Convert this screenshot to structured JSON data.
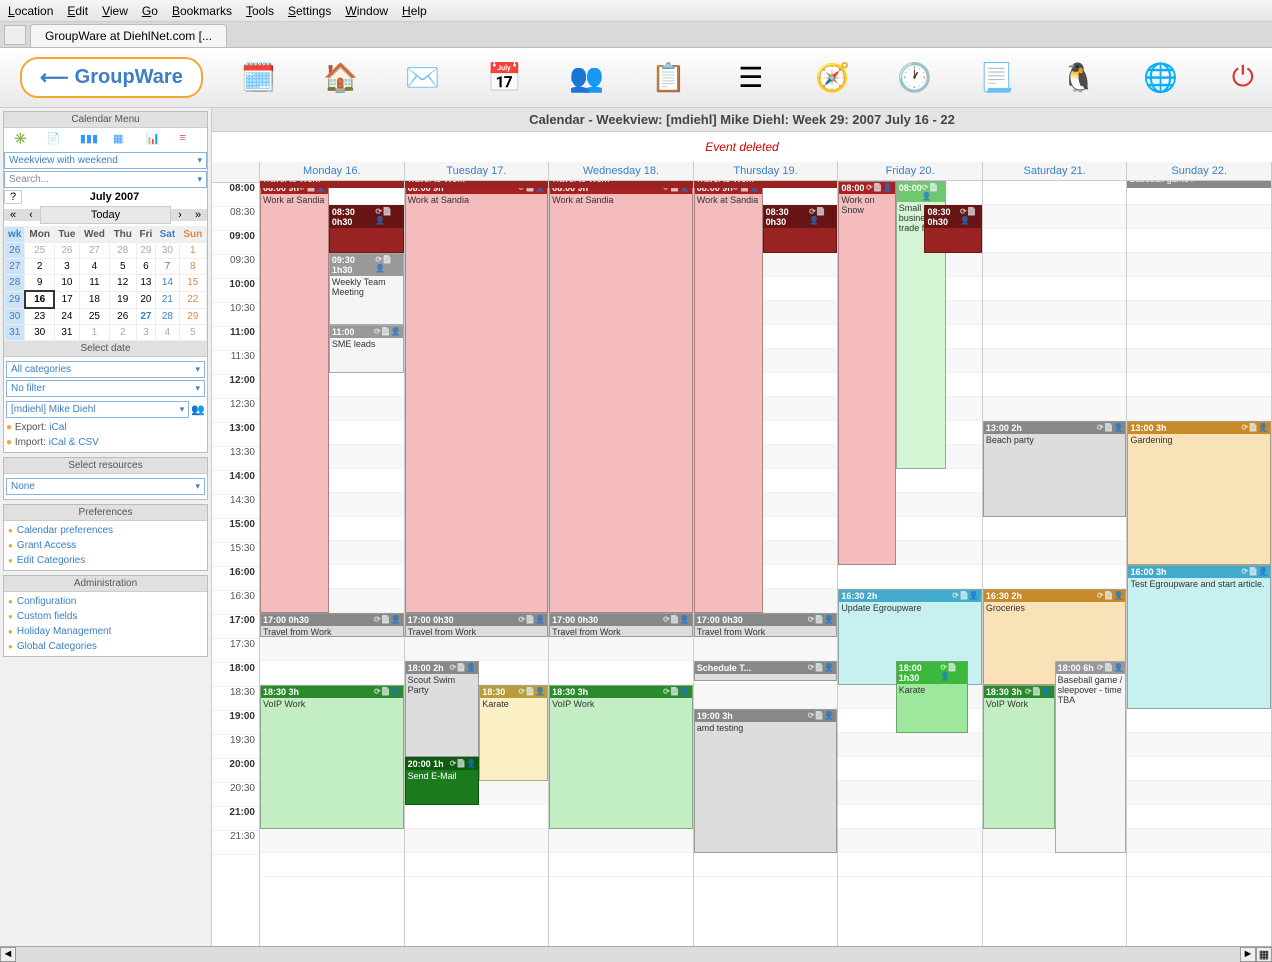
{
  "menubar": [
    "Location",
    "Edit",
    "View",
    "Go",
    "Bookmarks",
    "Tools",
    "Settings",
    "Window",
    "Help"
  ],
  "tab_title": "GroupWare at DiehlNet.com [...",
  "logo_text": "GroupWare",
  "sidebar": {
    "calendar_menu_title": "Calendar Menu",
    "view_select": "Weekview with weekend",
    "search_placeholder": "Search...",
    "month_title": "July 2007",
    "today_label": "Today",
    "select_date_label": "Select date",
    "category_select": "All categories",
    "filter_select": "No filter",
    "user_select": "[mdiehl] Mike Diehl",
    "export_label": "Export:",
    "export_link": "iCal",
    "import_label": "Import:",
    "import_link": "iCal & CSV",
    "resources_title": "Select resources",
    "resources_select": "None",
    "preferences_title": "Preferences",
    "pref_links": [
      "Calendar preferences",
      "Grant Access",
      "Edit Categories"
    ],
    "admin_title": "Administration",
    "admin_links": [
      "Configuration",
      "Custom fields",
      "Holiday Management",
      "Global Categories"
    ],
    "cal_headers": [
      "wk",
      "Mon",
      "Tue",
      "Wed",
      "Thu",
      "Fri",
      "Sat",
      "Sun"
    ],
    "cal_rows": [
      [
        "26",
        "25",
        "26",
        "27",
        "28",
        "29",
        "30",
        "1"
      ],
      [
        "27",
        "2",
        "3",
        "4",
        "5",
        "6",
        "7",
        "8"
      ],
      [
        "28",
        "9",
        "10",
        "11",
        "12",
        "13",
        "14",
        "15"
      ],
      [
        "29",
        "16",
        "17",
        "18",
        "19",
        "20",
        "21",
        "22"
      ],
      [
        "30",
        "23",
        "24",
        "25",
        "26",
        "27",
        "28",
        "29"
      ],
      [
        "31",
        "30",
        "31",
        "1",
        "2",
        "3",
        "4",
        "5"
      ]
    ]
  },
  "content_header": "Calendar - Weekview: [mdiehl] Mike Diehl: Week 29: 2007 July 16 - 22",
  "event_deleted": "Event deleted",
  "days": [
    "Monday 16.",
    "Tuesday 17.",
    "Wednesday 18.",
    "Thursday 19.",
    "Friday 20.",
    "Saturday 21.",
    "Sunday 22."
  ],
  "time_slots": [
    "08:00",
    "08:30",
    "09:00",
    "09:30",
    "10:00",
    "10:30",
    "11:00",
    "11:30",
    "12:00",
    "12:30",
    "13:00",
    "13:30",
    "14:00",
    "14:30",
    "15:00",
    "15:30",
    "16:00",
    "16:30",
    "17:00",
    "17:30",
    "18:00",
    "18:30",
    "19:00",
    "19:30",
    "20:00",
    "20:30",
    "21:00",
    "21:30"
  ],
  "events": {
    "travel_to_work": "Travel to Work",
    "travel_from_work": "Travel from Work",
    "work_sandia_hdr": "08:00 9h",
    "work_sandia": "Work at Sandia",
    "work_snow": "Work on Snow",
    "small_biz": "Small business trade fair",
    "small_biz_hdr": "08:00",
    "slot_0830": "08:30 0h30",
    "weekly_hdr": "09:30 1h30",
    "weekly": "Weekly Team Meeting",
    "sme_hdr": "11:00",
    "sme": "SME leads",
    "travel_1700": "17:00 0h30",
    "voip_hdr": "18:30 3h",
    "voip": "VoIP Work",
    "scout_hdr": "18:00 2h",
    "scout": "Scout Swim Party",
    "karate_hdr": "18:30",
    "karate": "Karate",
    "email_hdr": "20:00 1h",
    "email": "Send E-Mail",
    "sched_hdr": "Schedule T...",
    "amd_hdr": "19:00 3h",
    "amd": "amd testing",
    "update_hdr": "16:30 2h",
    "update": "Update Egroupware",
    "karate2_hdr": "18:00 1h30",
    "beach_hdr": "13:00 2h",
    "beach": "Beach party",
    "groc_hdr": "16:30 2h",
    "groc": "Groceries",
    "baseball_hdr": "18:00 6h",
    "baseball": "Baseball game / sleepover - time TBA",
    "baseball_top": "Baseball game /",
    "garden_hdr": "13:00 3h",
    "garden": "Gardening",
    "test_hdr": "16:00 3h",
    "test": "Test Egroupware and start article."
  }
}
